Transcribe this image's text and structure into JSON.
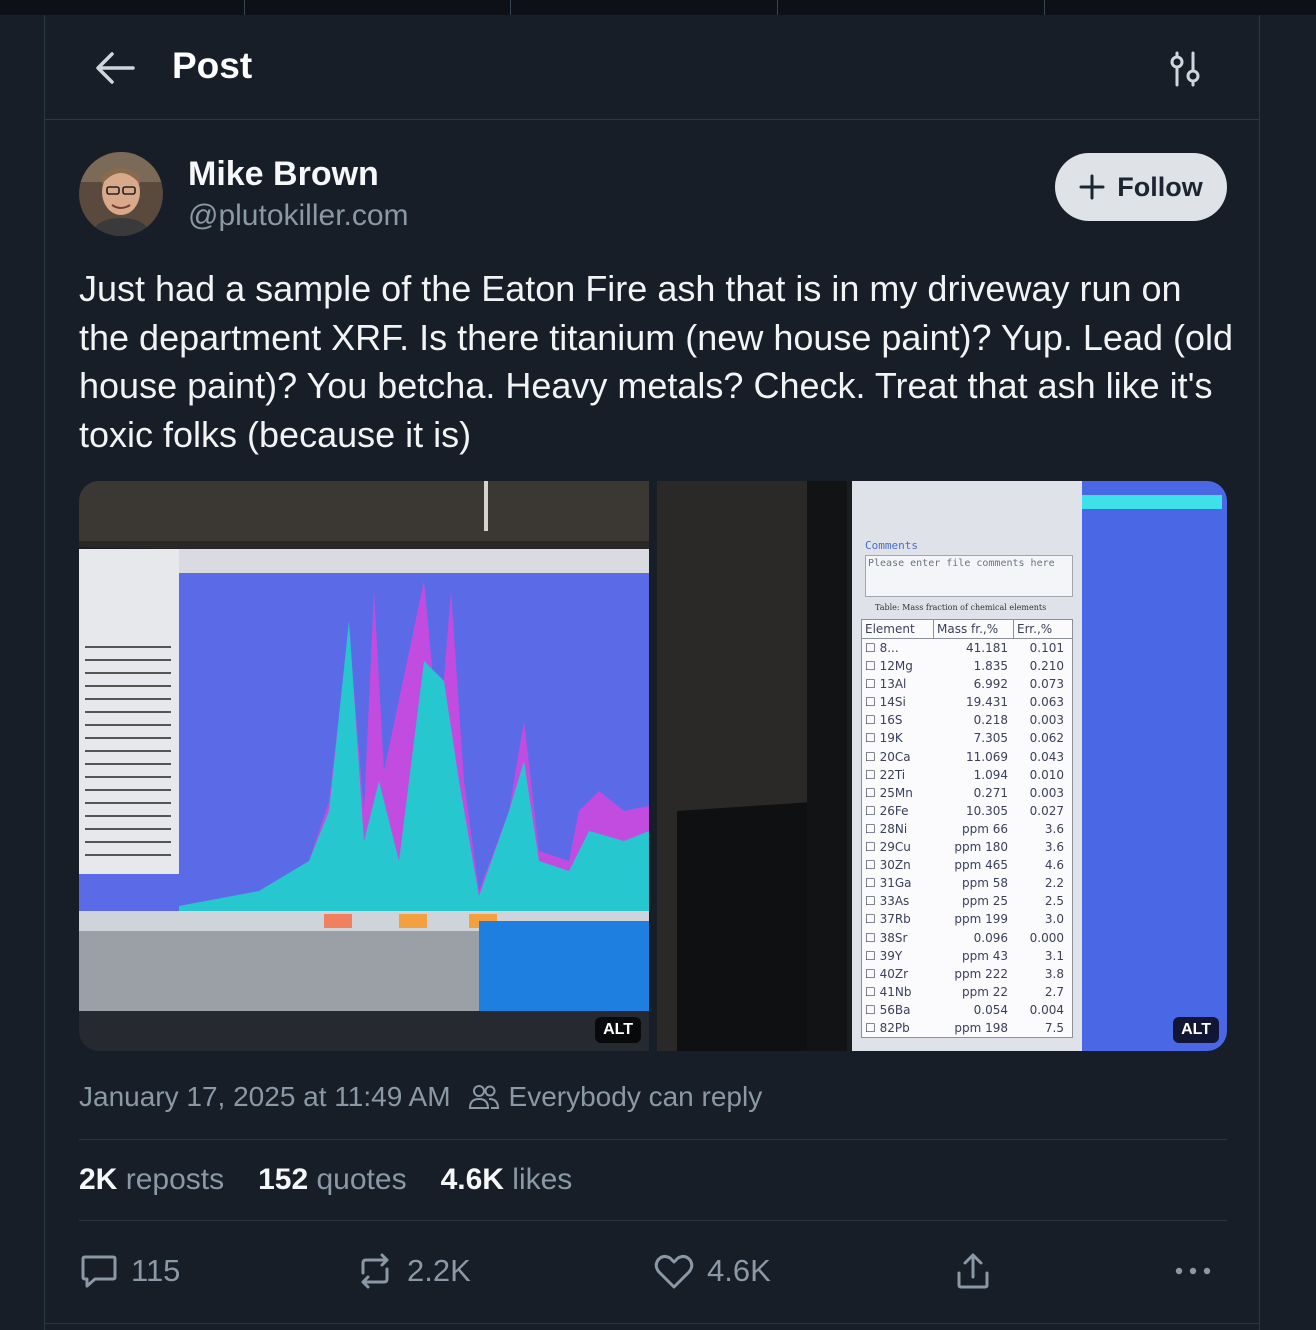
{
  "header": {
    "title": "Post"
  },
  "author": {
    "name": "Mike Brown",
    "handle": "@plutokiller.com",
    "follow_label": "Follow"
  },
  "post": {
    "text": "Just had a sample of the Eaton Fire ash that is in my driveway run on the department XRF. Is there titanium (new house paint)? Yup. Lead (old house paint)? You betcha. Heavy metals? Check. Treat that ash like it's toxic folks (because it is)",
    "timestamp": "January 17, 2025 at 11:49 AM",
    "reply_setting": "Everybody can reply"
  },
  "media": {
    "alt_label": "ALT",
    "right_table": {
      "comments_label": "Comments",
      "comments_placeholder": "Please enter file comments here",
      "table_title": "Table: Mass fraction of chemical elements",
      "headers": [
        "Element",
        "Mass fr.,%",
        "Err.,%"
      ],
      "rows": [
        [
          "8...",
          "41.181",
          "0.101"
        ],
        [
          "12Mg",
          "1.835",
          "0.210"
        ],
        [
          "13Al",
          "6.992",
          "0.073"
        ],
        [
          "14Si",
          "19.431",
          "0.063"
        ],
        [
          "16S",
          "0.218",
          "0.003"
        ],
        [
          "19K",
          "7.305",
          "0.062"
        ],
        [
          "20Ca",
          "11.069",
          "0.043"
        ],
        [
          "22Ti",
          "1.094",
          "0.010"
        ],
        [
          "25Mn",
          "0.271",
          "0.003"
        ],
        [
          "26Fe",
          "10.305",
          "0.027"
        ],
        [
          "28Ni",
          "ppm 66",
          "3.6"
        ],
        [
          "29Cu",
          "ppm 180",
          "3.6"
        ],
        [
          "30Zn",
          "ppm 465",
          "4.6"
        ],
        [
          "31Ga",
          "ppm 58",
          "2.2"
        ],
        [
          "33As",
          "ppm 25",
          "2.5"
        ],
        [
          "37Rb",
          "ppm 199",
          "3.0"
        ],
        [
          "38Sr",
          "0.096",
          "0.000"
        ],
        [
          "39Y",
          "ppm 43",
          "3.1"
        ],
        [
          "40Zr",
          "ppm 222",
          "3.8"
        ],
        [
          "41Nb",
          "ppm 22",
          "2.7"
        ],
        [
          "56Ba",
          "0.054",
          "0.004"
        ],
        [
          "82Pb",
          "ppm 198",
          "7.5"
        ]
      ]
    }
  },
  "stats": {
    "reposts_count": "2K",
    "reposts_label": "reposts",
    "quotes_count": "152",
    "quotes_label": "quotes",
    "likes_count": "4.6K",
    "likes_label": "likes"
  },
  "actions": {
    "replies": "115",
    "reposts": "2.2K",
    "likes": "4.6K"
  },
  "colors": {
    "background": "#171e27",
    "follow_bg": "#dfe3e8",
    "muted": "#8b98a6"
  }
}
